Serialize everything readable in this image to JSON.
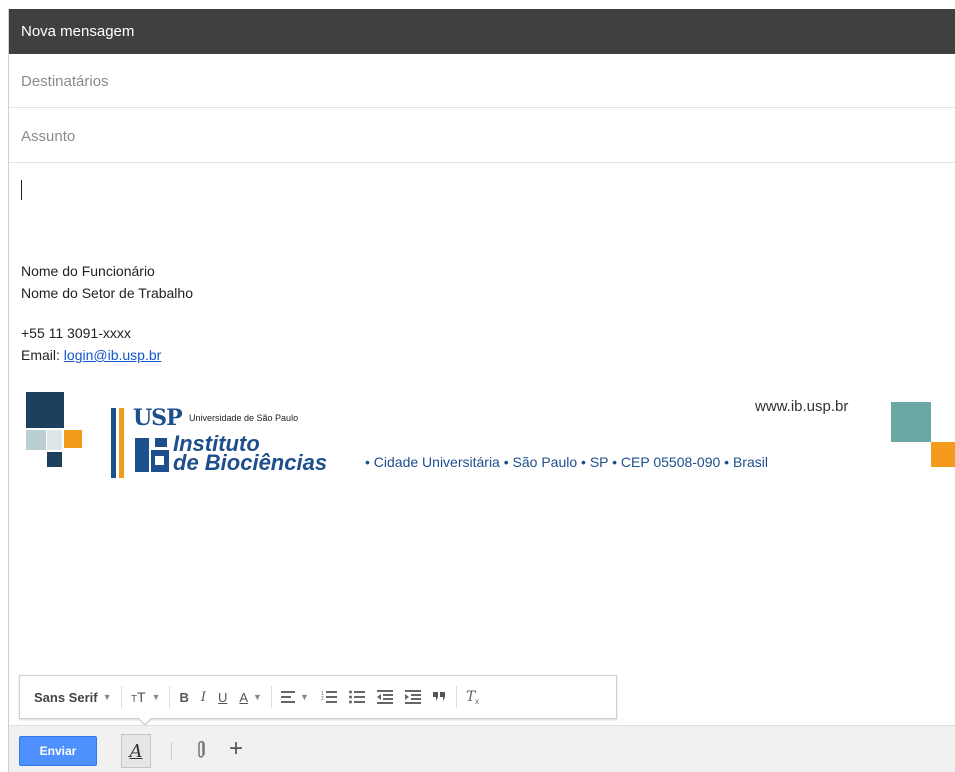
{
  "window": {
    "title": "Nova mensagem"
  },
  "fields": {
    "to_placeholder": "Destinatários",
    "subject_placeholder": "Assunto"
  },
  "signature": {
    "name": "Nome do Funcionário",
    "sector": "Nome do Setor de Trabalho",
    "phone": "+55 11 3091-xxxx",
    "email_label": "Email: ",
    "email_link": "login@ib.usp.br"
  },
  "banner": {
    "usp": "USP",
    "university": "Universidade de São Paulo",
    "institute_line1": "Instituto",
    "institute_line2": "de Biociências",
    "website": "www.ib.usp.br",
    "address": "• Cidade Universitária • São Paulo • SP • CEP 05508-090 • Brasil"
  },
  "format_toolbar": {
    "font": "Sans Serif",
    "size_icon": "text-size-icon",
    "bold": "B",
    "italic": "I",
    "underline": "U",
    "text_color": "A",
    "icons": [
      "align-icon",
      "numbered-list-icon",
      "bulleted-list-icon",
      "indent-less-icon",
      "indent-more-icon",
      "quote-icon",
      "remove-formatting-icon"
    ]
  },
  "bottom_bar": {
    "send_label": "Enviar",
    "format_toggle": "A",
    "attach_icon": "paperclip-icon",
    "more_icon": "plus-icon"
  },
  "colors": {
    "titlebar": "#404040",
    "send": "#4d90fe",
    "link": "#1155cc",
    "usp_blue": "#1d4f8c",
    "usp_orange": "#f29b1d",
    "teal": "#6aa8a3"
  }
}
